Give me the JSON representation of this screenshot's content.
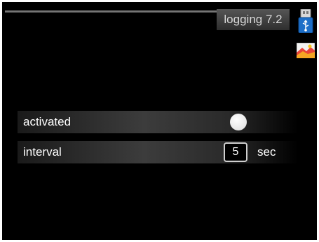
{
  "header": {
    "title": "logging 7.2",
    "icons": [
      "usb-icon",
      "system-icon"
    ]
  },
  "settings": {
    "activated": {
      "label": "activated",
      "checked": true
    },
    "interval": {
      "label": "interval",
      "value": "5",
      "unit": "sec"
    }
  },
  "colors": {
    "background": "#000000",
    "text": "#ffffff",
    "title_text": "#d8d8d8",
    "usb_blue": "#1e6fc8"
  }
}
